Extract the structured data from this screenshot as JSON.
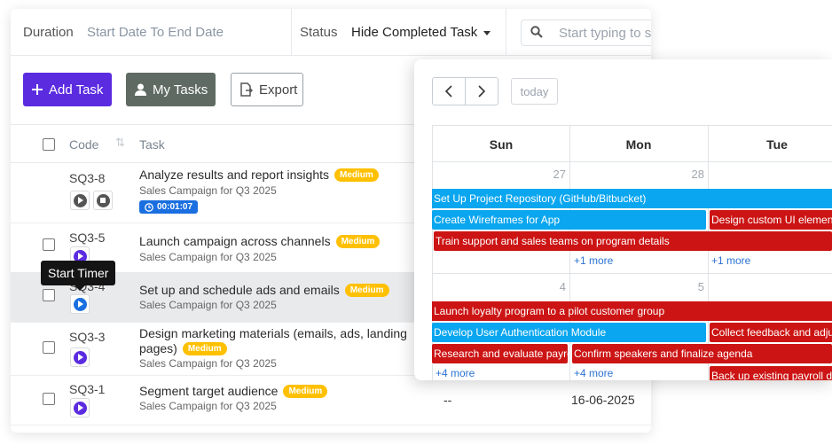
{
  "filters": {
    "duration_label": "Duration",
    "duration_value": "Start Date To End Date",
    "status_label": "Status",
    "status_value": "Hide Completed Task",
    "search_placeholder": "Start typing to s"
  },
  "toolbar": {
    "add_task": "Add Task",
    "my_tasks": "My Tasks",
    "export": "Export"
  },
  "table": {
    "headers": {
      "code": "Code",
      "task": "Task"
    },
    "rows": [
      {
        "code": "SQ3-8",
        "task": "Analyze results and report insights",
        "priority": "Medium",
        "project": "Sales Campaign for Q3 2025",
        "timer": "00:01:07"
      },
      {
        "code": "SQ3-5",
        "task": "Launch campaign across channels",
        "priority": "Medium",
        "project": "Sales Campaign for Q3 2025"
      },
      {
        "code": "SQ3-4",
        "task": "Set up and schedule ads and emails",
        "priority": "Medium",
        "project": "Sales Campaign for Q3 2025"
      },
      {
        "code": "SQ3-3",
        "task_line1": "Design marketing materials (emails, ads, landing",
        "task_line2": "pages)",
        "priority": "Medium",
        "project": "Sales Campaign for Q3 2025"
      },
      {
        "code": "SQ3-1",
        "task": "Segment target audience",
        "priority": "Medium",
        "project": "Sales Campaign for Q3 2025",
        "assignee": "--",
        "date": "16-06-2025"
      }
    ]
  },
  "tooltip": "Start Timer",
  "calendar": {
    "today": "today",
    "days": [
      "Sun",
      "Mon",
      "Tue"
    ],
    "week1": {
      "dates": [
        "27",
        "28"
      ],
      "events": [
        "Set Up Project Repository (GitHub/Bitbucket)",
        "Create Wireframes for App",
        "Design custom UI elemen",
        "Train support and sales teams on program details"
      ],
      "more_mon": "+1 more",
      "more_tue": "+1 more"
    },
    "week2": {
      "dates": [
        "4",
        "5"
      ],
      "events": [
        "Launch loyalty program to a pilot customer group",
        "Develop User Authentication Module",
        "Collect feedback and adju",
        "Research and evaluate payro",
        "Confirm speakers and finalize agenda",
        "Back up existing payroll d"
      ],
      "more_sun": "+4 more",
      "more_mon": "+4 more"
    }
  },
  "colors": {
    "primary": "#5b2be0",
    "badge": "#ffc000",
    "event_blue": "#0aa6ef",
    "event_red": "#cc1414",
    "link": "#2c73d2"
  }
}
